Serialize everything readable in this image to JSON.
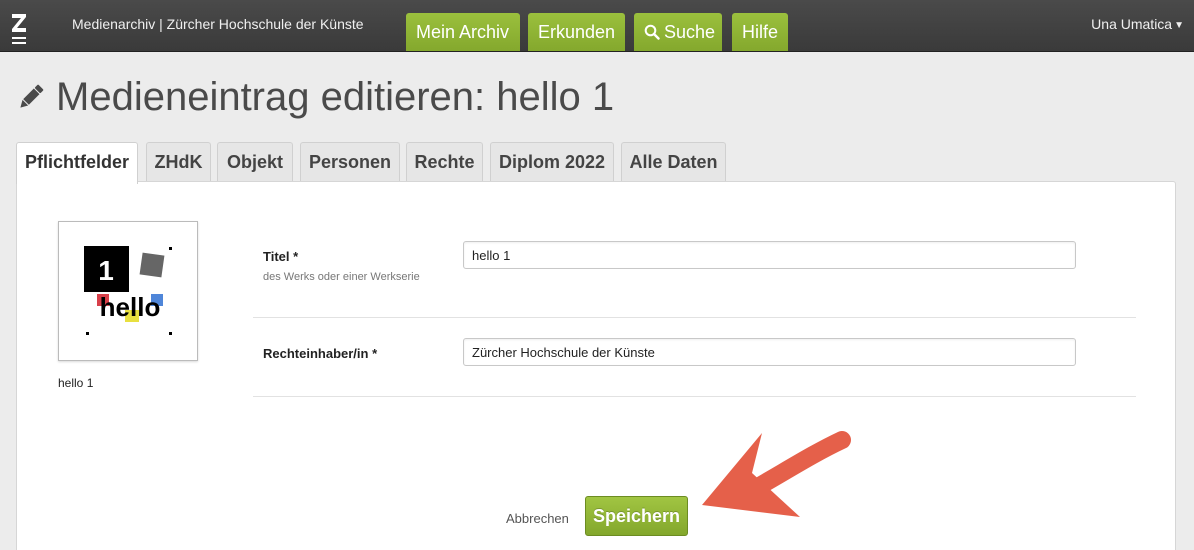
{
  "header": {
    "brand": "Medienarchiv | Zürcher Hochschule der Künste",
    "nav": {
      "archiv": "Mein Archiv",
      "erkunden": "Erkunden",
      "suche": "Suche",
      "hilfe": "Hilfe"
    },
    "user": "Una Umatica",
    "accent_color": "#8db135",
    "bar_color": "#414141"
  },
  "page": {
    "title": "Medieneintrag editieren: hello 1"
  },
  "tabs": [
    "Pflichtfelder",
    "ZHdK",
    "Objekt",
    "Personen",
    "Rechte",
    "Diplom 2022",
    "Alle Daten"
  ],
  "active_tab": "Pflichtfelder",
  "media": {
    "thumb_big_number": "1",
    "thumb_word": "hello",
    "caption": "hello 1"
  },
  "form": {
    "title_label": "Titel *",
    "title_hint": "des Werks oder einer Werkserie",
    "title_value": "hello 1",
    "rights_label": "Rechteinhaber/in *",
    "rights_value": "Zürcher Hochschule der Künste"
  },
  "actions": {
    "cancel": "Abbrechen",
    "save": "Speichern"
  }
}
